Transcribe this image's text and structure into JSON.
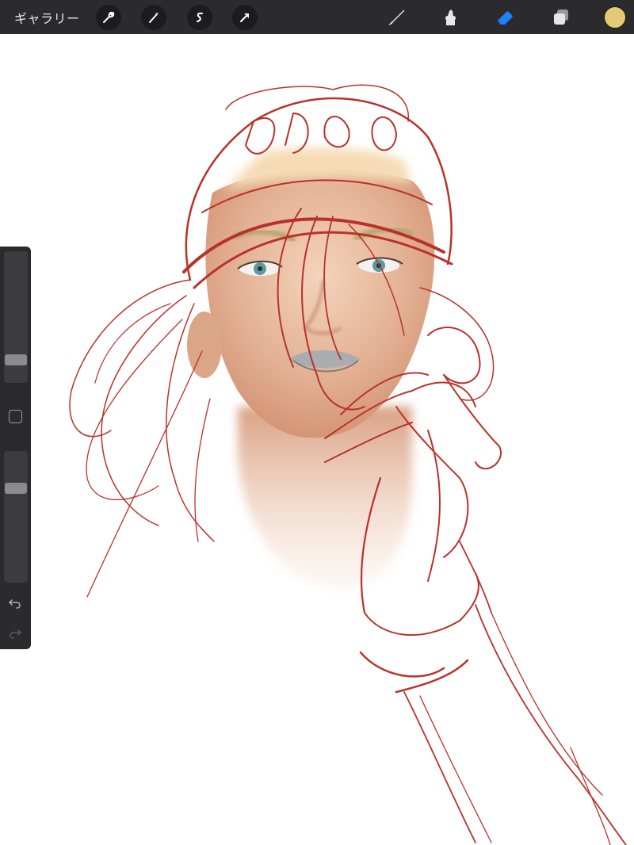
{
  "topbar": {
    "gallery_label": "ギャラリー",
    "left_tools": [
      "wrench-icon",
      "magic-wand-icon",
      "selection-icon",
      "transform-arrow-icon"
    ],
    "right_tools": [
      "brush-icon",
      "smudge-icon",
      "eraser-icon",
      "layers-icon"
    ],
    "active_tool": "eraser",
    "current_color": "#e5c975",
    "active_color": "#1e82ff"
  },
  "sidebar": {
    "brush_size_level": 0.15,
    "opacity_level": 0.72,
    "modify_button": "square-icon",
    "undo": "undo-icon",
    "redo": "redo-icon"
  },
  "canvas": {
    "sketch_color": "#b8322a",
    "skin_color": "#e8b99a"
  }
}
